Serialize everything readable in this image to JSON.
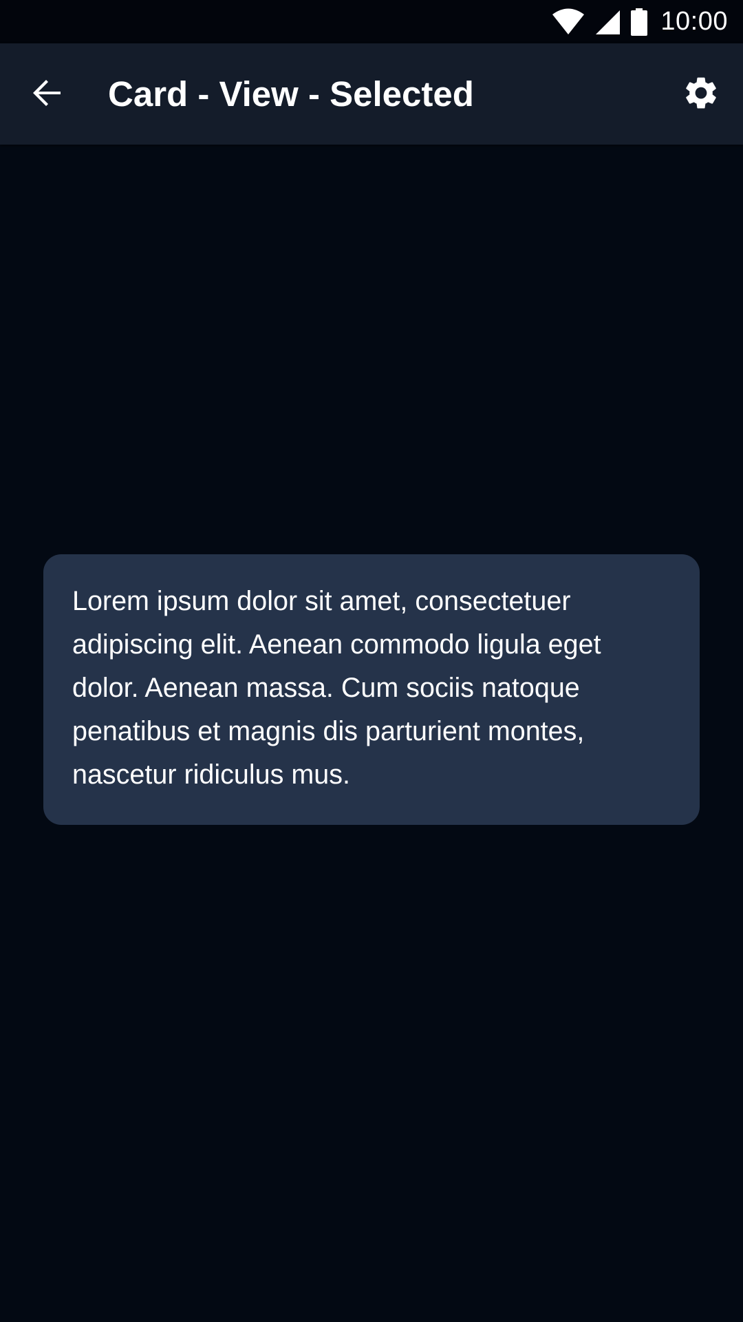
{
  "status_bar": {
    "time": "10:00",
    "icons": [
      "wifi-icon",
      "cellular-signal-icon",
      "battery-icon"
    ]
  },
  "app_bar": {
    "back_icon": "arrow-back-icon",
    "title": "Card - View - Selected",
    "settings_icon": "gear-icon"
  },
  "card": {
    "selected": true,
    "text": "Lorem ipsum dolor sit amet, consectetuer adipiscing elit. Aenean commodo ligula eget dolor. Aenean massa. Cum sociis natoque penatibus et magnis dis parturient montes, nascetur ridiculus mus."
  },
  "colors": {
    "background": "#030913",
    "status_bar": "#02050c",
    "app_bar": "#141c2a",
    "card": "#25334a",
    "text": "#ffffff"
  }
}
